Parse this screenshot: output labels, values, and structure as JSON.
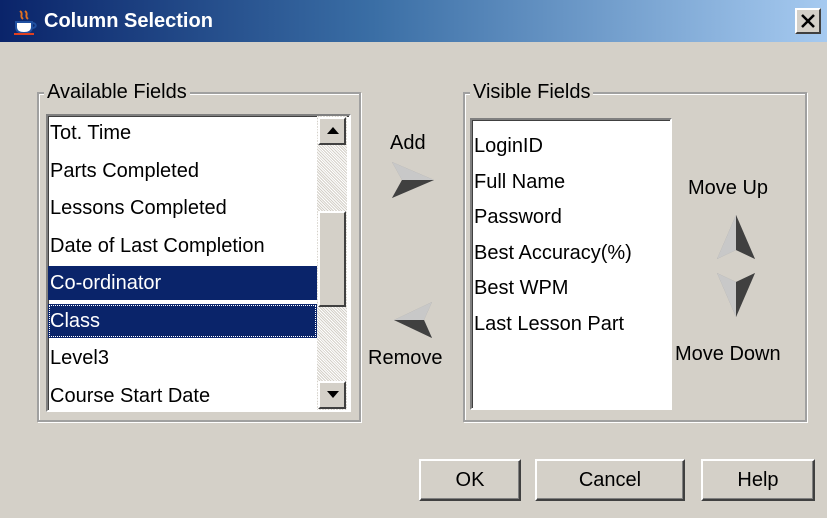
{
  "window": {
    "title": "Column Selection"
  },
  "available": {
    "legend": "Available Fields",
    "items": [
      {
        "label": "Tot. Time",
        "selected": false
      },
      {
        "label": "Parts Completed",
        "selected": false
      },
      {
        "label": "Lessons Completed",
        "selected": false
      },
      {
        "label": "Date of Last Completion",
        "selected": false
      },
      {
        "label": "Co-ordinator",
        "selected": true
      },
      {
        "label": "Class",
        "selected": true
      },
      {
        "label": "Level3",
        "selected": false
      },
      {
        "label": "Course Start Date",
        "selected": false
      }
    ]
  },
  "visible": {
    "legend": "Visible Fields",
    "items": [
      {
        "label": "LoginID"
      },
      {
        "label": "Full Name"
      },
      {
        "label": "Password"
      },
      {
        "label": "Best Accuracy(%)"
      },
      {
        "label": "Best WPM"
      },
      {
        "label": "Last Lesson Part"
      }
    ]
  },
  "actions": {
    "add_label": "Add",
    "remove_label": "Remove",
    "move_up_label": "Move Up",
    "move_down_label": "Move Down"
  },
  "buttons": {
    "ok": "OK",
    "cancel": "Cancel",
    "help": "Help"
  },
  "icons": {
    "title": "java-cup-icon",
    "close": "close-icon",
    "add": "arrow-right-icon",
    "remove": "arrow-left-icon",
    "move_up": "arrow-up-icon",
    "move_down": "arrow-down-icon"
  },
  "colors": {
    "titlebar_start": "#0a246a",
    "titlebar_end": "#a6caf0",
    "selection": "#0a246a",
    "face": "#d4d0c8"
  }
}
